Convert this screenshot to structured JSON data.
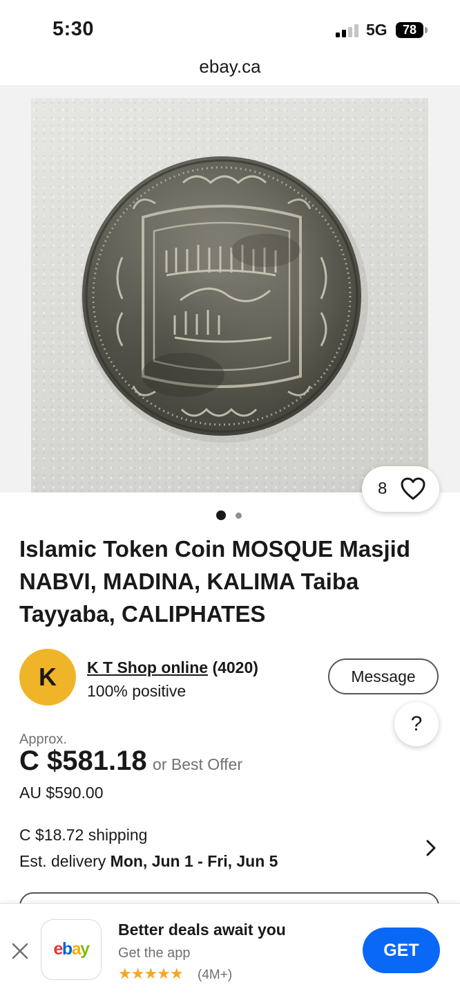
{
  "status_bar": {
    "time": "5:30",
    "network": "5G",
    "battery": "78"
  },
  "browser": {
    "url": "ebay.ca"
  },
  "gallery": {
    "watch_count": "8",
    "image_count": 2,
    "active_image_index": 0
  },
  "listing": {
    "title": "Islamic Token Coin MOSQUE Masjid NABVI, MADINA, KALIMA Taiba Tayyaba, CALIPHATES"
  },
  "seller": {
    "avatar_letter": "K",
    "name": "K T Shop online",
    "feedback_count": "(4020)",
    "positive": "100% positive",
    "message_label": "Message",
    "help_label": "?"
  },
  "price": {
    "approx_label": "Approx.",
    "amount": "C $581.18",
    "offer_label": "or Best Offer",
    "original": "AU $590.00"
  },
  "shipping": {
    "cost": "C $18.72 shipping",
    "delivery_label": "Est. delivery",
    "delivery_dates": "Mon, Jun 1 - Fri, Jun 5"
  },
  "app_banner": {
    "logo_letters": [
      "e",
      "b",
      "a",
      "y"
    ],
    "logo_colors": [
      "#e53238",
      "#0064d2",
      "#f5af02",
      "#86b817"
    ],
    "title": "Better deals await you",
    "subtitle": "Get the app",
    "stars": "★★★★★",
    "reviews": "(4M+)",
    "cta_label": "GET"
  },
  "colors": {
    "accent_blue": "#0968f6",
    "avatar_yellow": "#f0b429",
    "star_orange": "#f5a623"
  }
}
